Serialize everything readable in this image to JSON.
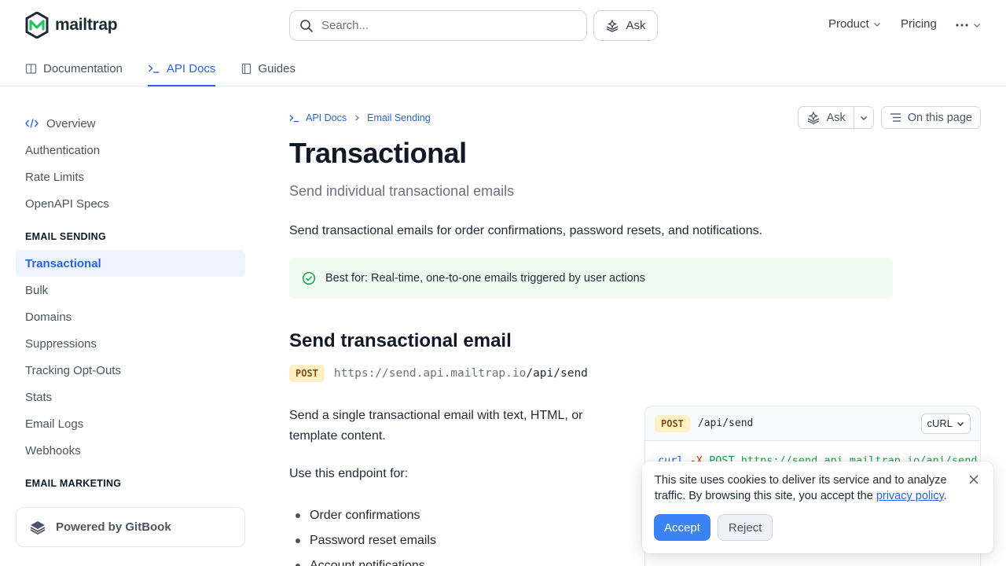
{
  "header": {
    "logo_text": "mailtrap",
    "search_placeholder": "Search...",
    "ask_label": "Ask",
    "nav": {
      "product": "Product",
      "pricing": "Pricing"
    }
  },
  "tabs": [
    {
      "label": "Documentation",
      "icon": "book-icon"
    },
    {
      "label": "API Docs",
      "icon": "terminal-icon",
      "active": true
    },
    {
      "label": "Guides",
      "icon": "notebook-icon"
    }
  ],
  "sidebar": {
    "items_top": [
      "Overview",
      "Authentication",
      "Rate Limits",
      "OpenAPI Specs"
    ],
    "section_email_sending": "EMAIL SENDING",
    "items_sending": [
      "Transactional",
      "Bulk",
      "Domains",
      "Suppressions",
      "Tracking Opt-Outs",
      "Stats",
      "Email Logs",
      "Webhooks"
    ],
    "section_email_marketing": "EMAIL MARKETING",
    "powered_by": "Powered by GitBook"
  },
  "breadcrumb": {
    "root": "API Docs",
    "current": "Email Sending"
  },
  "page_actions": {
    "ask": "Ask",
    "on_this_page": "On this page"
  },
  "page": {
    "title": "Transactional",
    "subtitle": "Send individual transactional emails",
    "lead": "Send transactional emails for order confirmations, password resets, and notifications.",
    "hint": "Best for: Real-time, one-to-one emails triggered by user actions",
    "section_title": "Send transactional email",
    "method": "POST",
    "url_host": "https://send.api.mailtrap.io",
    "url_path": "/api/send",
    "description": "Send a single transactional email with text, HTML, or template content.",
    "use_for": "Use this endpoint for:",
    "bullets": [
      "Order confirmations",
      "Password reset emails",
      "Account notifications"
    ]
  },
  "code_panel": {
    "method": "POST",
    "path": "/api/send",
    "language": "cURL",
    "line1_cmd": "curl",
    "line1_flag": "-X",
    "line1_method": "POST",
    "line1_url": "https://send.api.mailtrap.io/api/send"
  },
  "cookie": {
    "text": "This site uses cookies to deliver its service and to analyze traffic. By browsing this site, you accept the ",
    "link": "privacy policy",
    "after": ".",
    "accept": "Accept",
    "reject": "Reject"
  },
  "colors": {
    "accent": "#2563eb",
    "hint_bg": "#f0fbf2",
    "logo_green": "#22c55e",
    "logo_dark": "#1f2933"
  }
}
